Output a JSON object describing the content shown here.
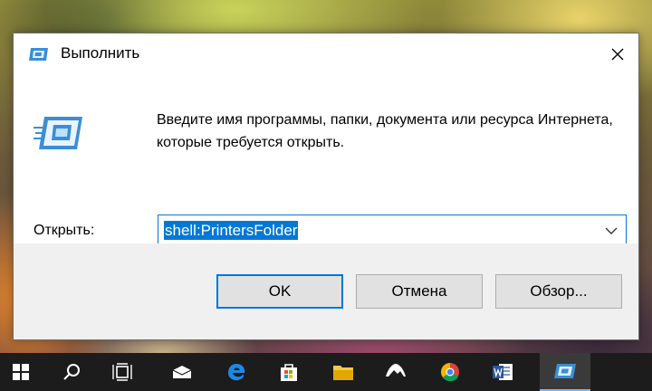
{
  "dialog": {
    "title": "Выполнить",
    "message": "Введите имя программы, папки, документа или ресурса Интернета, которые требуется открыть.",
    "open_label": "Открыть:",
    "open_value": "shell:PrintersFolder",
    "buttons": {
      "ok": "OK",
      "cancel": "Отмена",
      "browse": "Обзор..."
    }
  },
  "taskbar": {
    "items": [
      "start-icon",
      "search-icon",
      "task-view-icon",
      "mail-icon",
      "edge-icon",
      "store-icon",
      "file-explorer-icon",
      "photos-icon",
      "chrome-icon",
      "word-icon",
      "run-icon"
    ]
  },
  "colors": {
    "accent": "#0078d7",
    "taskbar": "#1c1c1c",
    "footer": "#f0f0f0"
  }
}
